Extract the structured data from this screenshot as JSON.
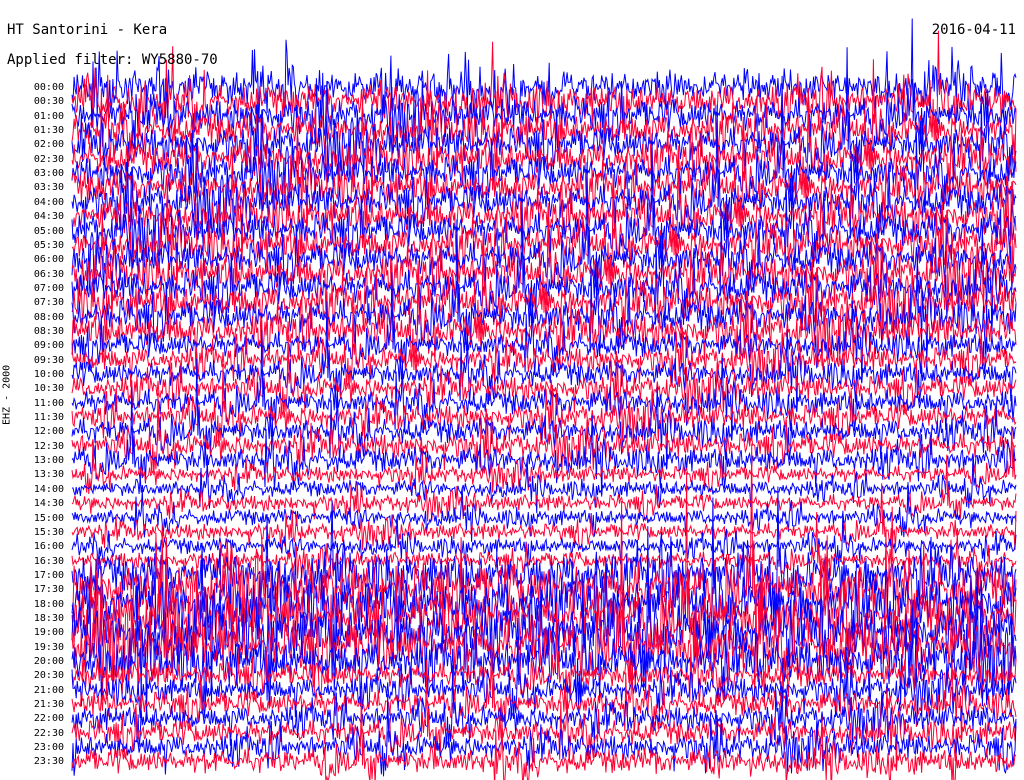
{
  "header": {
    "title": "HT Santorini - Kera",
    "date": "2016-04-11",
    "filter": "Applied filter: WY5880-70"
  },
  "side_label": "EHZ - 2000",
  "colors": {
    "trace_a": "#0000ff",
    "trace_b": "#ff0033",
    "background": "#ffffff"
  },
  "chart_data": {
    "type": "line",
    "title": "HT Santorini - Kera",
    "ylabel": "EHZ - 2000",
    "row_labels": [
      "00:00",
      "00:30",
      "01:00",
      "01:30",
      "02:00",
      "02:30",
      "03:00",
      "03:30",
      "04:00",
      "04:30",
      "05:00",
      "05:30",
      "06:00",
      "06:30",
      "07:00",
      "07:30",
      "08:00",
      "08:30",
      "09:00",
      "09:30",
      "10:00",
      "10:30",
      "11:00",
      "11:30",
      "12:00",
      "12:30",
      "13:00",
      "13:30",
      "14:00",
      "14:30",
      "15:00",
      "15:30",
      "16:00",
      "16:30",
      "17:00",
      "17:30",
      "18:00",
      "18:30",
      "19:00",
      "19:30",
      "20:00",
      "20:30",
      "21:00",
      "21:30",
      "22:00",
      "22:30",
      "23:00",
      "23:30"
    ],
    "series": [
      {
        "color": "#0000ff"
      },
      {
        "color": "#ff0033"
      }
    ],
    "amplitude_by_row": [
      4,
      4,
      4,
      4,
      4,
      4,
      4,
      4,
      4,
      4,
      4,
      4,
      4,
      4,
      4,
      4,
      4,
      4,
      3,
      3,
      3,
      3,
      3,
      3,
      3,
      3,
      3,
      2,
      2,
      2,
      2,
      2,
      2,
      2,
      5,
      6,
      6,
      6,
      6,
      6,
      5,
      3,
      3,
      3,
      3,
      3,
      3,
      3
    ]
  }
}
